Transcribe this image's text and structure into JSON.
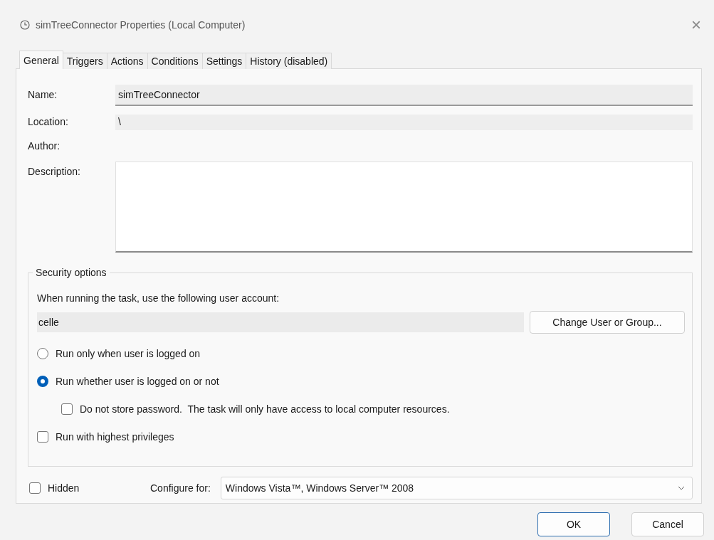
{
  "window": {
    "title": "simTreeConnector Properties (Local Computer)",
    "close": "×"
  },
  "tabs": [
    {
      "label": "General",
      "selected": true
    },
    {
      "label": "Triggers",
      "selected": false
    },
    {
      "label": "Actions",
      "selected": false
    },
    {
      "label": "Conditions",
      "selected": false
    },
    {
      "label": "Settings",
      "selected": false
    },
    {
      "label": "History (disabled)",
      "selected": false
    }
  ],
  "fields": [
    {
      "kind": "readonly",
      "label": "Name:",
      "value": "simTreeConnector"
    },
    {
      "kind": "plain",
      "label": "Location:",
      "value": "\\"
    },
    {
      "kind": "none",
      "label": "Author:"
    },
    {
      "kind": "textarea",
      "label": "Description:"
    }
  ],
  "security": {
    "title": "Security options",
    "prompt": "When running the task, use the following user account:",
    "account": "celle",
    "change_button": "Change User or Group...",
    "options": [
      {
        "kind": "radio",
        "label": "Run only when user is logged on",
        "selected": false
      },
      {
        "kind": "radio",
        "label": "Run whether user is logged on or not",
        "selected": true
      },
      {
        "kind": "subcheckbox",
        "label": "Do not store password.  The task will only have access to local computer resources.",
        "checked": false
      },
      {
        "kind": "checkbox",
        "label": "Run with highest privileges",
        "checked": false
      }
    ]
  },
  "hidden": {
    "label": "Hidden",
    "checked": false
  },
  "configure": {
    "label": "Configure for:",
    "value": "Windows Vista™, Windows Server™ 2008"
  },
  "buttons": [
    {
      "label": "OK",
      "default": true
    },
    {
      "label": "Cancel",
      "default": false
    }
  ]
}
